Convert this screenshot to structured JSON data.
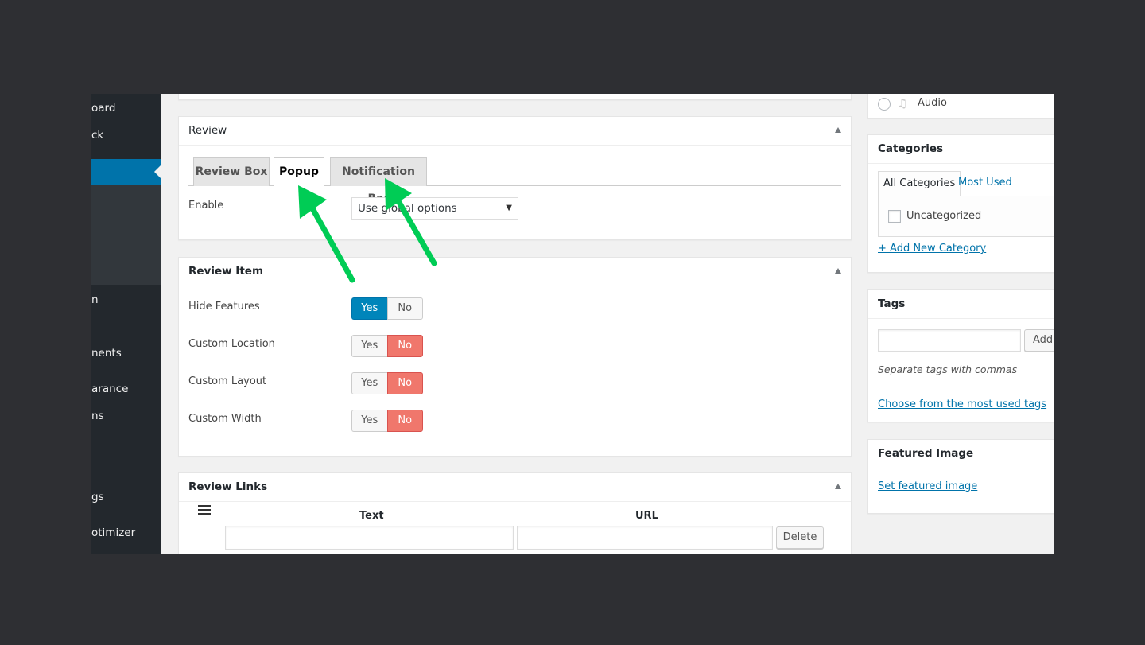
{
  "sidebar": {
    "items": [
      {
        "label": "oard",
        "full": "Dashboard"
      },
      {
        "label": "ck"
      },
      {
        "label": ""
      },
      {
        "label": "n"
      },
      {
        "label": "nents"
      },
      {
        "label": "arance"
      },
      {
        "label": "ns"
      },
      {
        "label": "gs"
      },
      {
        "label": "otimizer"
      }
    ]
  },
  "review": {
    "title": "Review",
    "tabs": [
      {
        "label": "Review Box",
        "active": false
      },
      {
        "label": "Popup",
        "active": true
      },
      {
        "label": "Notification Bar",
        "active": false
      }
    ],
    "enable_label": "Enable",
    "enable_value": "Use global options",
    "caret": "▼"
  },
  "review_item": {
    "title": "Review Item",
    "rows": [
      {
        "label": "Hide Features",
        "yes": "Yes",
        "no": "No",
        "value": "Yes"
      },
      {
        "label": "Custom Location",
        "yes": "Yes",
        "no": "No",
        "value": "No"
      },
      {
        "label": "Custom Layout",
        "yes": "Yes",
        "no": "No",
        "value": "No"
      },
      {
        "label": "Custom Width",
        "yes": "Yes",
        "no": "No",
        "value": "No"
      }
    ]
  },
  "review_links": {
    "title": "Review Links",
    "col_text": "Text",
    "col_url": "URL",
    "text_value": "",
    "url_value": "",
    "delete_label": "Delete"
  },
  "format": {
    "audio_label": "Audio"
  },
  "categories": {
    "title": "Categories",
    "tab_all": "All Categories",
    "tab_most_used": "Most Used",
    "items": [
      {
        "label": "Uncategorized",
        "checked": false
      }
    ],
    "add_new": "+ Add New Category"
  },
  "tags": {
    "title": "Tags",
    "input_value": "",
    "add_label": "Add",
    "hint": "Separate tags with commas",
    "choose_link": "Choose from the most used tags"
  },
  "featured_image": {
    "title": "Featured Image",
    "set_link": "Set featured image"
  },
  "colors": {
    "accent": "#0073aa",
    "toggle_yes": "#0085ba",
    "toggle_no": "#f0776c",
    "annotation_arrow": "#00cc55"
  }
}
